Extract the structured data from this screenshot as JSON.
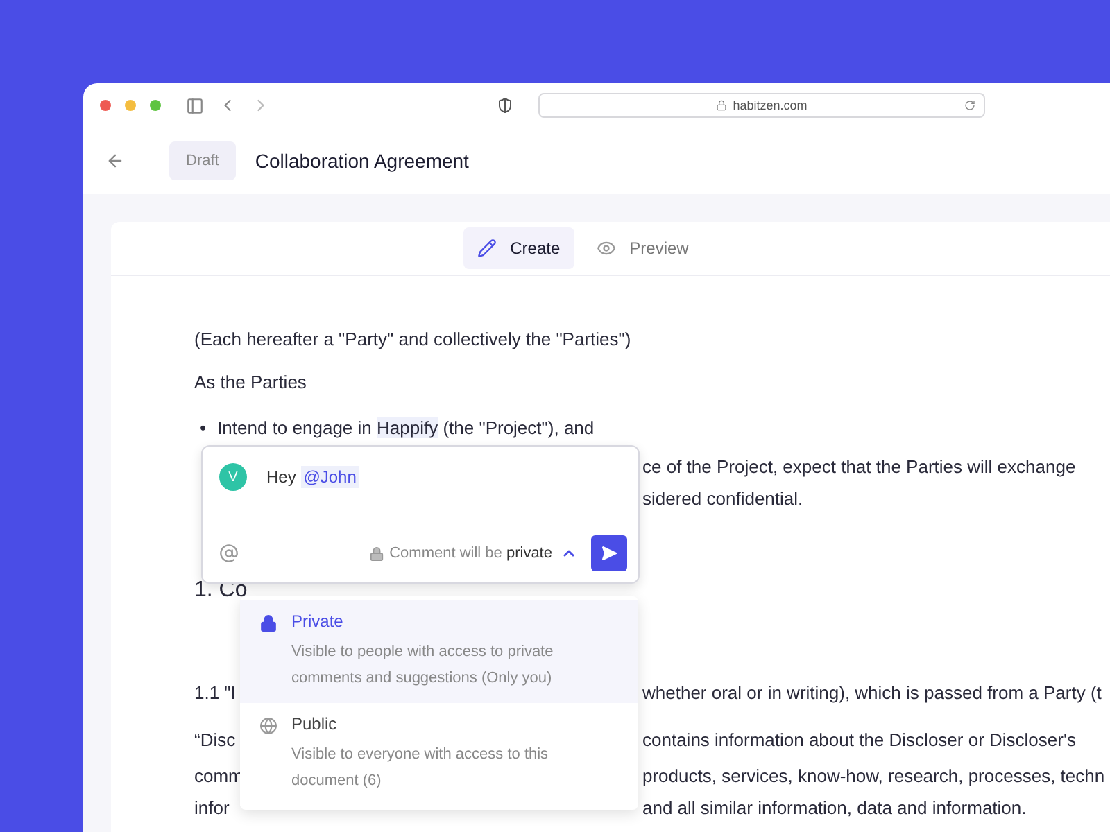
{
  "browser": {
    "url": "habitzen.com"
  },
  "header": {
    "status": "Draft",
    "title": "Collaboration Agreement"
  },
  "mode_tabs": [
    {
      "label": "Create",
      "selected": true
    },
    {
      "label": "Preview",
      "selected": false
    }
  ],
  "document": [
    {
      "kind": "full",
      "text": "(Each hereafter a \"Party\" and collectively the \"Parties\")"
    },
    {
      "kind": "full",
      "text": "As the Parties"
    },
    {
      "kind": "bullet",
      "bullet": "•",
      "before": "Intend to engage in ",
      "highlight": "Happify",
      "after": " (the \"Project\"), and"
    },
    {
      "kind": "split",
      "right": "ce of the Project, expect that the Parties will exchange"
    },
    {
      "kind": "split",
      "right": "sidered confidential."
    },
    {
      "kind": "heading",
      "left": "1. Co"
    },
    {
      "kind": "split",
      "left": "1.1 \"I",
      "right": "whether oral or in writing), which is passed from a Party (t"
    },
    {
      "kind": "split",
      "left": "“Disc",
      "right": "contains information about the Discloser or Discloser's"
    },
    {
      "kind": "split",
      "left": "comm",
      "right": "products, services, know-how, research, processes, techn"
    },
    {
      "kind": "split",
      "left": "infor",
      "right": "and all similar information, data and information."
    }
  ],
  "comment": {
    "avatar": "V",
    "text": "Hey ",
    "mention": "@John",
    "visibility_prefix": "Comment will be",
    "visibility": "private",
    "menu_open": true
  },
  "visibility_options": [
    {
      "label": "Private",
      "description": "Visible to people with access to private comments and suggestions (Only you)",
      "selected": true
    },
    {
      "label": "Public",
      "description": "Visible to everyone with access to this document (6)",
      "selected": false
    }
  ]
}
